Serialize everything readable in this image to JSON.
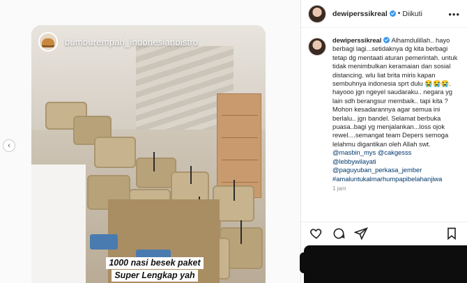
{
  "story": {
    "username": "bumburempah_indonesianbistro",
    "caption_line1": "1000 nasi besek paket",
    "caption_line2": "Super Lengkap yah",
    "caption_line3": "#####"
  },
  "post": {
    "username": "dewiperssikreal",
    "follow_status": "Diikuti",
    "comment_username": "dewiperssikreal",
    "comment_body": "Alhamdulillah.. hayo berbagi lagi...setidaknya dg kita berbagi tetap dg mentaati aturan pemerintah. untuk tidak menimbulkan keramaian dan sosial distancing. wlu liat brita miris kapan sembuhnya indonesia sprt dulu 😭😭😭. hayooo jgn ngeyel saudaraku.. negara yg lain sdh berangsur membaik.. tapi kita ? Mohon kesadarannya agar semua ini berlalu.. jgn bandel. Selamat berbuka puasa..bagi yg menjalankan...loss ojok rewel....semangat team Depers semoga lelahmu digantikan oleh Allah swt.",
    "mentions": [
      "@masbin_mys @cakgesss",
      "@lebbywilayati",
      "@paguyuban_perkasa_jember",
      "#amaluntukalmarhumpapibelahanjiwa"
    ],
    "time": "1 jam"
  },
  "colors": {
    "accent": "#3897f0",
    "link": "#00376b",
    "redaction": "#0d0d0d"
  }
}
